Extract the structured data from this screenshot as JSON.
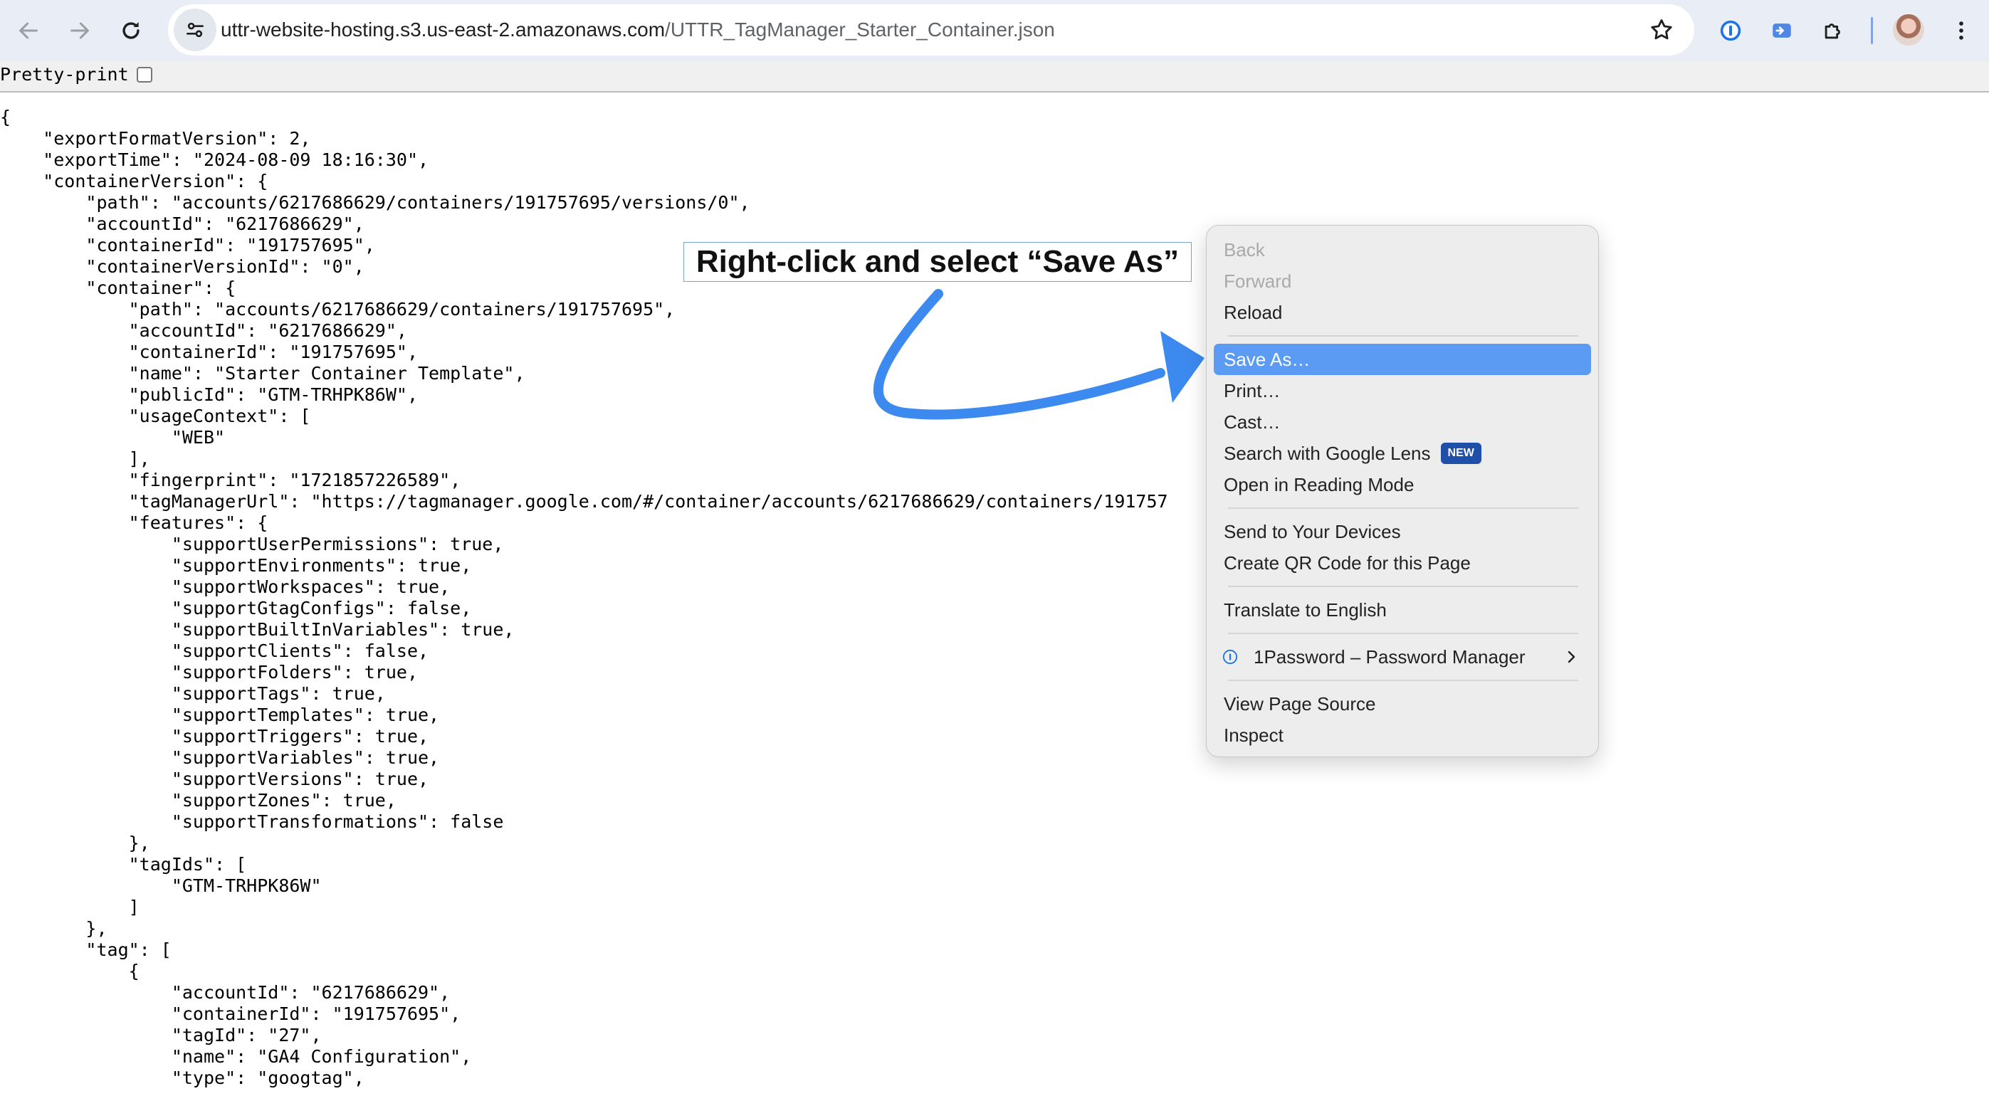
{
  "browser": {
    "url_host": "uttr-website-hosting.s3.us-east-2.amazonaws.com",
    "url_path": "/UTTR_TagManager_Starter_Container.json",
    "accent": "#e9eef6"
  },
  "viewer": {
    "pretty_print_label": "Pretty-print",
    "pretty_print_checked": false,
    "json_lines": [
      "{",
      "    \"exportFormatVersion\": 2,",
      "    \"exportTime\": \"2024-08-09 18:16:30\",",
      "    \"containerVersion\": {",
      "        \"path\": \"accounts/6217686629/containers/191757695/versions/0\",",
      "        \"accountId\": \"6217686629\",",
      "        \"containerId\": \"191757695\",",
      "        \"containerVersionId\": \"0\",",
      "        \"container\": {",
      "            \"path\": \"accounts/6217686629/containers/191757695\",",
      "            \"accountId\": \"6217686629\",",
      "            \"containerId\": \"191757695\",",
      "            \"name\": \"Starter Container Template\",",
      "            \"publicId\": \"GTM-TRHPK86W\",",
      "            \"usageContext\": [",
      "                \"WEB\"",
      "            ],",
      "            \"fingerprint\": \"1721857226589\",",
      "            \"tagManagerUrl\": \"https://tagmanager.google.com/#/container/accounts/6217686629/containers/191757",
      "            \"features\": {",
      "                \"supportUserPermissions\": true,",
      "                \"supportEnvironments\": true,",
      "                \"supportWorkspaces\": true,",
      "                \"supportGtagConfigs\": false,",
      "                \"supportBuiltInVariables\": true,",
      "                \"supportClients\": false,",
      "                \"supportFolders\": true,",
      "                \"supportTags\": true,",
      "                \"supportTemplates\": true,",
      "                \"supportTriggers\": true,",
      "                \"supportVariables\": true,",
      "                \"supportVersions\": true,",
      "                \"supportZones\": true,",
      "                \"supportTransformations\": false",
      "            },",
      "            \"tagIds\": [",
      "                \"GTM-TRHPK86W\"",
      "            ]",
      "        },",
      "        \"tag\": [",
      "            {",
      "                \"accountId\": \"6217686629\",",
      "                \"containerId\": \"191757695\",",
      "                \"tagId\": \"27\",",
      "                \"name\": \"GA4 Configuration\",",
      "                \"type\": \"googtag\","
    ]
  },
  "annotation": {
    "text": "Right-click and select “Save As”",
    "arrow_color": "#3c8af0"
  },
  "context_menu": {
    "back": "Back",
    "forward": "Forward",
    "reload": "Reload",
    "save_as": "Save As…",
    "print": "Print…",
    "cast": "Cast…",
    "search_lens": "Search with Google Lens",
    "new_badge": "NEW",
    "reading_mode": "Open in Reading Mode",
    "send_devices": "Send to Your Devices",
    "qr_code": "Create QR Code for this Page",
    "translate": "Translate to English",
    "onepassword": "1Password – Password Manager",
    "view_source": "View Page Source",
    "inspect": "Inspect",
    "highlight_color": "#5b9bf4"
  }
}
